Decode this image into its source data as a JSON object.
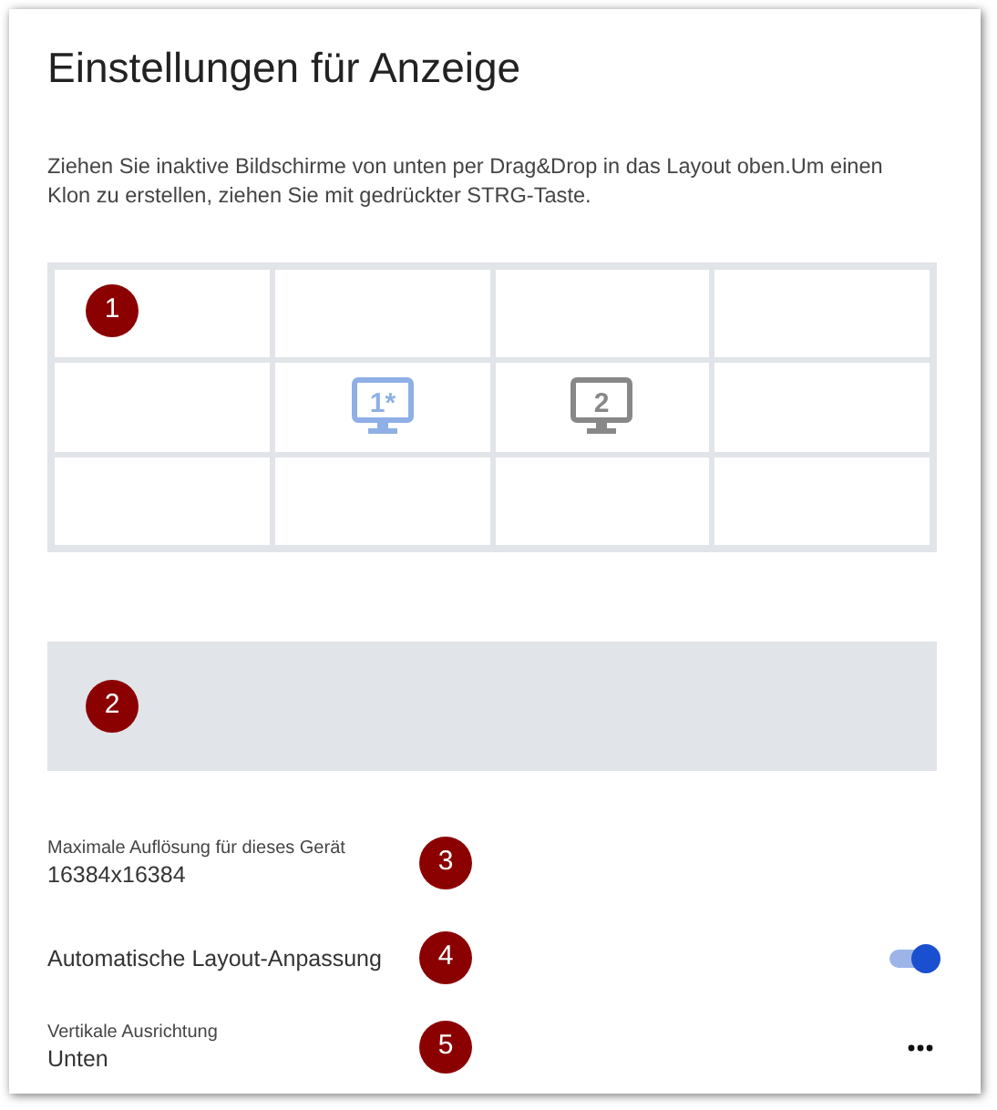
{
  "title": "Einstellungen für Anzeige",
  "description": "Ziehen Sie inaktive Bildschirme von unten per Drag&Drop in das Layout oben.Um einen Klon zu erstellen, ziehen Sie mit gedrückter STRG-Taste.",
  "layout_grid": {
    "callout": "1",
    "cells": [
      {},
      {},
      {},
      {},
      {},
      {
        "monitor": {
          "label": "1*",
          "active": true
        }
      },
      {
        "monitor": {
          "label": "2",
          "active": false
        }
      },
      {},
      {},
      {},
      {},
      {}
    ]
  },
  "inactive_area": {
    "callout": "2"
  },
  "settings": [
    {
      "kind": "info",
      "label": "Maximale Auflösung für dieses Gerät",
      "value": "16384x16384",
      "callout": "3"
    },
    {
      "kind": "toggle",
      "label": "Automatische Layout-Anpassung",
      "on": true,
      "callout": "4"
    },
    {
      "kind": "menu",
      "label": "Vertikale Ausrichtung",
      "value": "Unten",
      "callout": "5"
    }
  ]
}
